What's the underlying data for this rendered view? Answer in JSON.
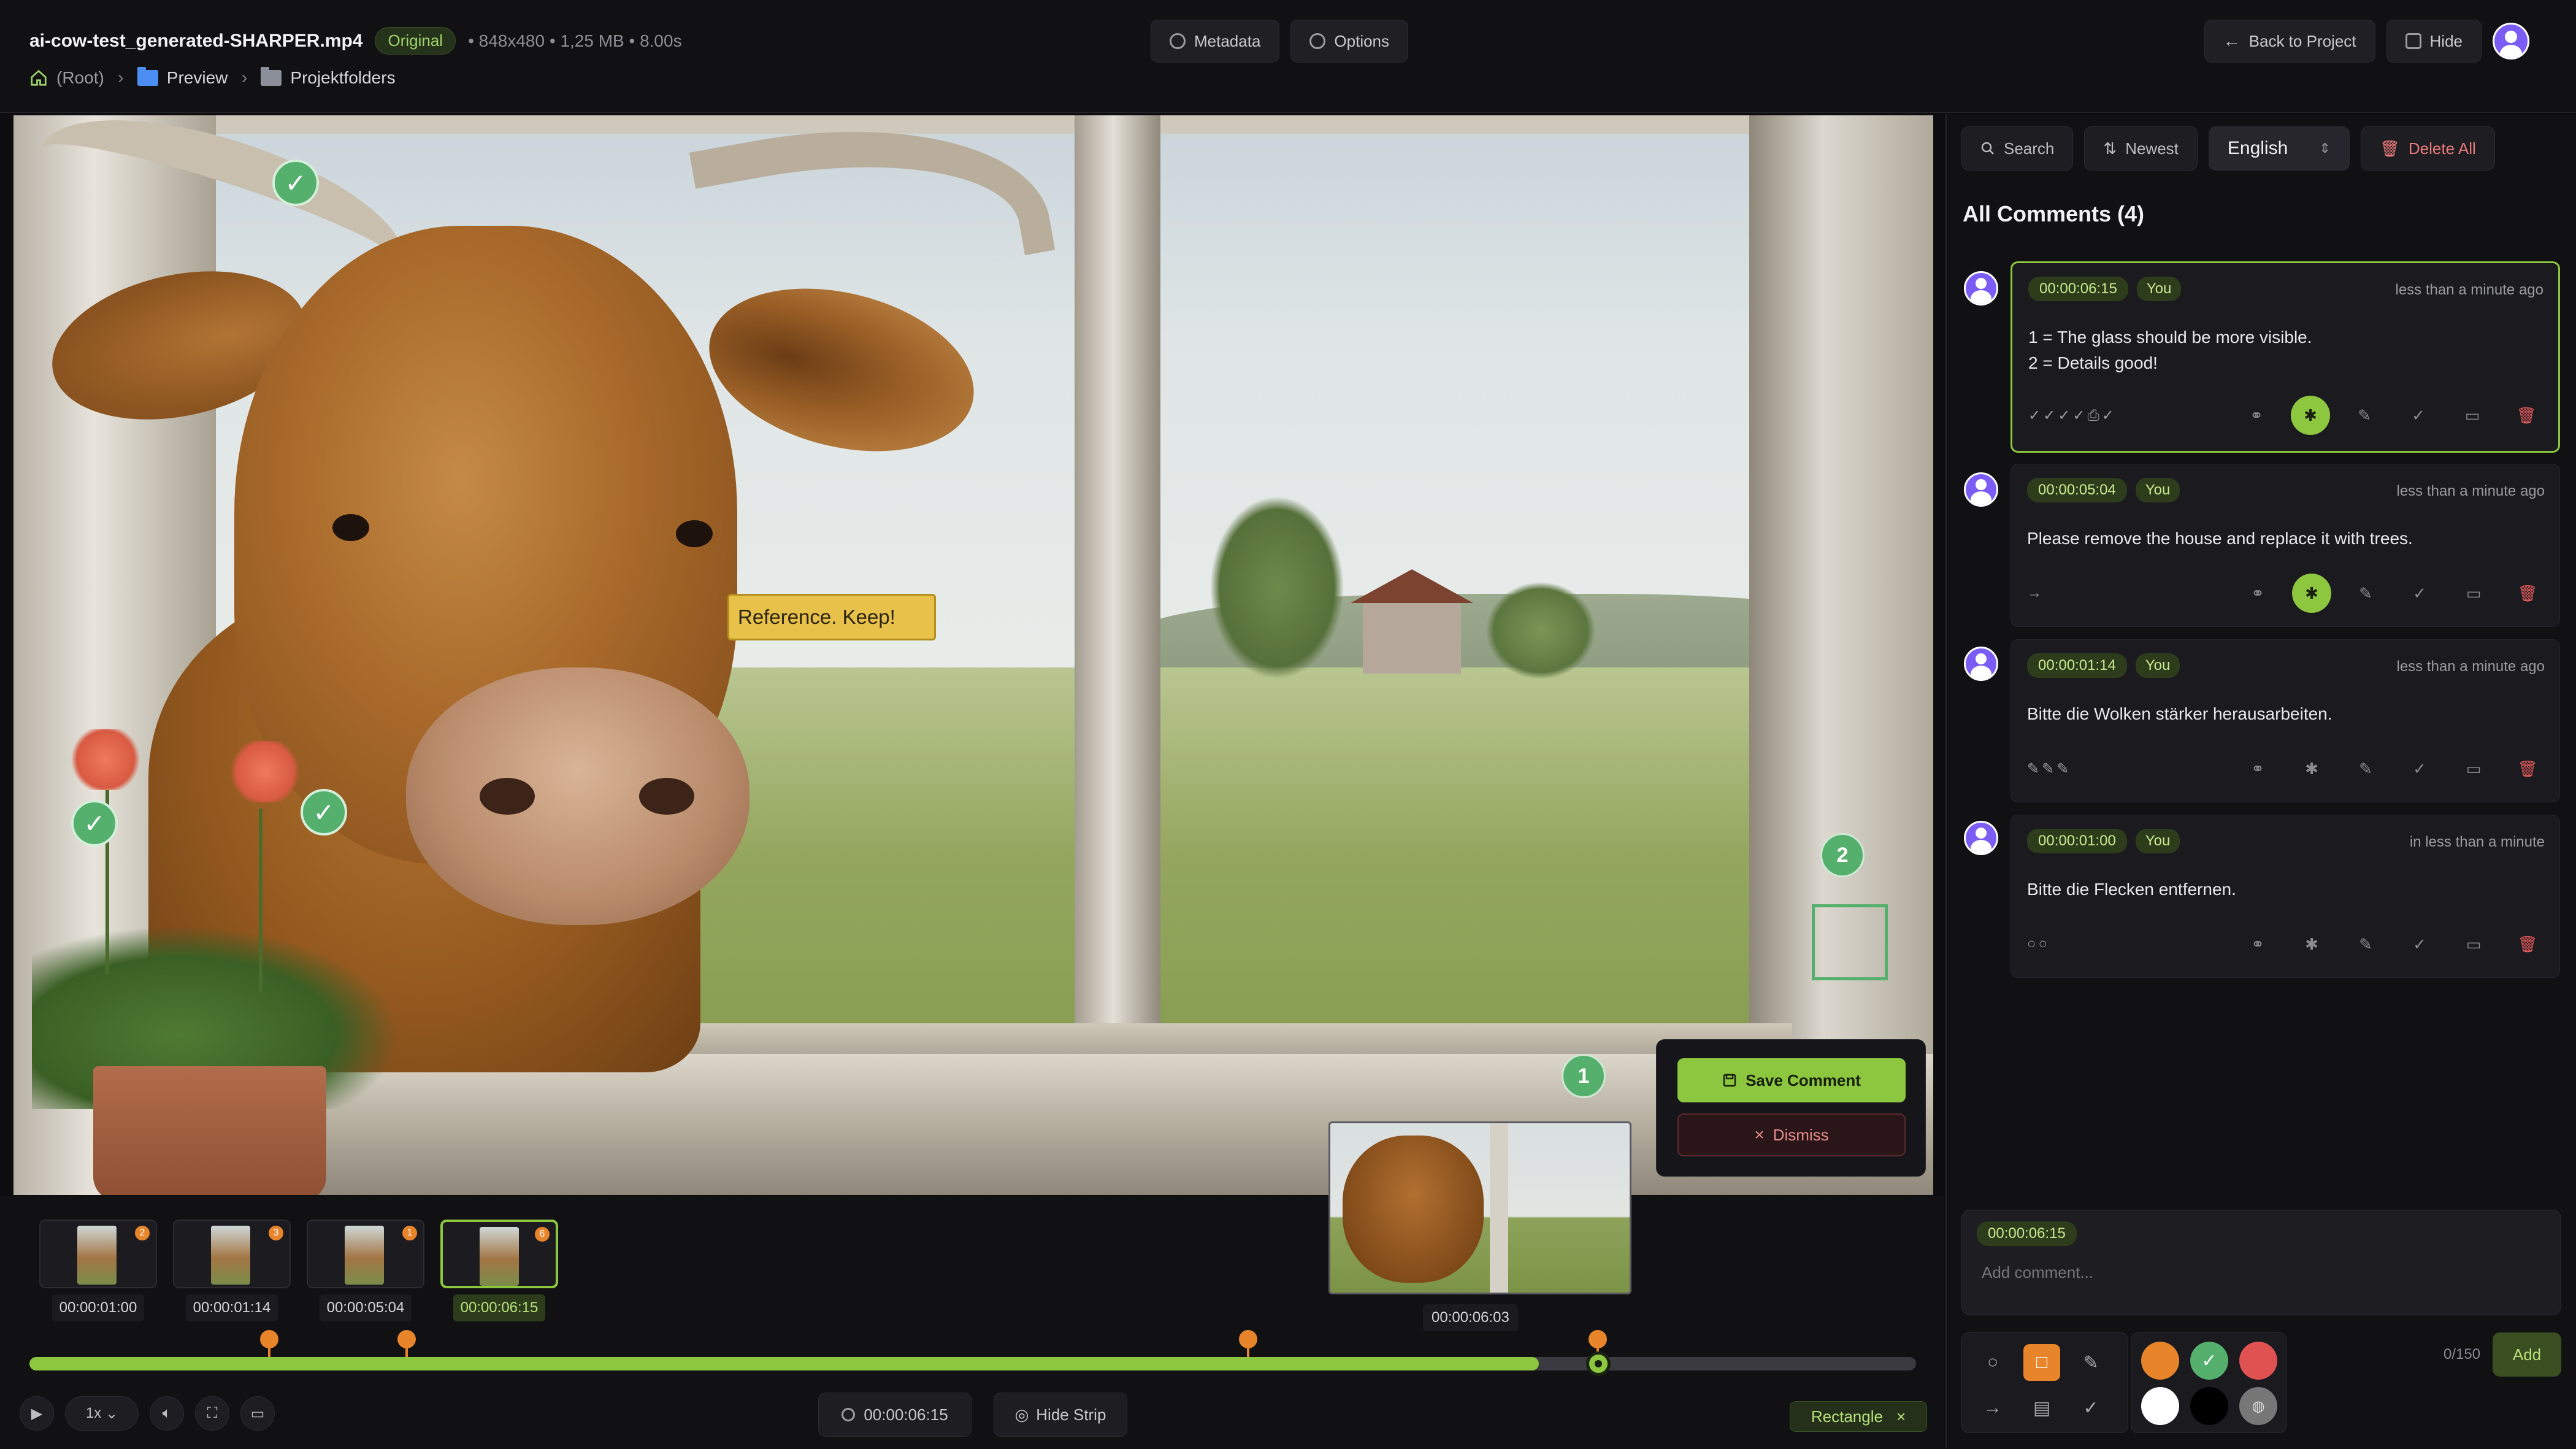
{
  "header": {
    "file_name": "ai-cow-test_generated-SHARPER.mp4",
    "version_badge": "Original",
    "file_meta": "• 848x480 • 1,25 MB • 8.00s",
    "breadcrumb": [
      "(Root)",
      "Preview",
      "Projektfolders"
    ],
    "metadata_label": "Metadata",
    "options_label": "Options",
    "back_label": "Back to Project",
    "hide_label": "Hide"
  },
  "viewer": {
    "reference_label": "Reference. Keep!",
    "marker_numbers": [
      "1",
      "2"
    ],
    "save_comment_label": "Save Comment",
    "dismiss_label": "Dismiss",
    "check_glyph": "✓"
  },
  "timeline": {
    "thumbnails": [
      {
        "time": "00:00:01:00",
        "badge": "2"
      },
      {
        "time": "00:00:01:14",
        "badge": "3"
      },
      {
        "time": "00:00:05:04",
        "badge": "1"
      },
      {
        "time": "00:00:06:15",
        "badge": "6"
      }
    ],
    "preview_time": "00:00:06:03",
    "progress_fraction": 0.8,
    "speed_label": "1x",
    "current_time": "00:00:06:15",
    "hide_strip_label": "Hide Strip",
    "tool_label": "Rectangle"
  },
  "comments_panel": {
    "search_label": "Search",
    "sort_label": "Newest",
    "language": "English",
    "delete_all_label": "Delete All",
    "title": "All Comments (4)",
    "comments": [
      {
        "timestamp": "00:00:06:15",
        "author": "You",
        "ago": "less than a minute ago",
        "lines": [
          "1 = The glass should be more visible.",
          "2 = Details good!"
        ],
        "marks": "✓✓✓✓⎙✓"
      },
      {
        "timestamp": "00:00:05:04",
        "author": "You",
        "ago": "less than a minute ago",
        "lines": [
          "Please remove the house and replace it with trees."
        ],
        "marks": "→"
      },
      {
        "timestamp": "00:00:01:14",
        "author": "You",
        "ago": "less than a minute ago",
        "lines": [
          "Bitte die Wolken stärker herausarbeiten."
        ],
        "marks": "✎✎✎"
      },
      {
        "timestamp": "00:00:01:00",
        "author": "You",
        "ago": "in less than a minute",
        "lines": [
          "Bitte die Flecken entfernen."
        ],
        "marks": "○○"
      }
    ],
    "compose": {
      "timestamp": "00:00:06:15",
      "placeholder": "Add comment...",
      "counter": "0/150",
      "add_label": "Add"
    },
    "colors": {
      "orange": "#e8852a",
      "green": "#55b06e",
      "red": "#e05252",
      "white": "#ffffff",
      "black": "#000000",
      "accent": "#8dc63f"
    }
  }
}
